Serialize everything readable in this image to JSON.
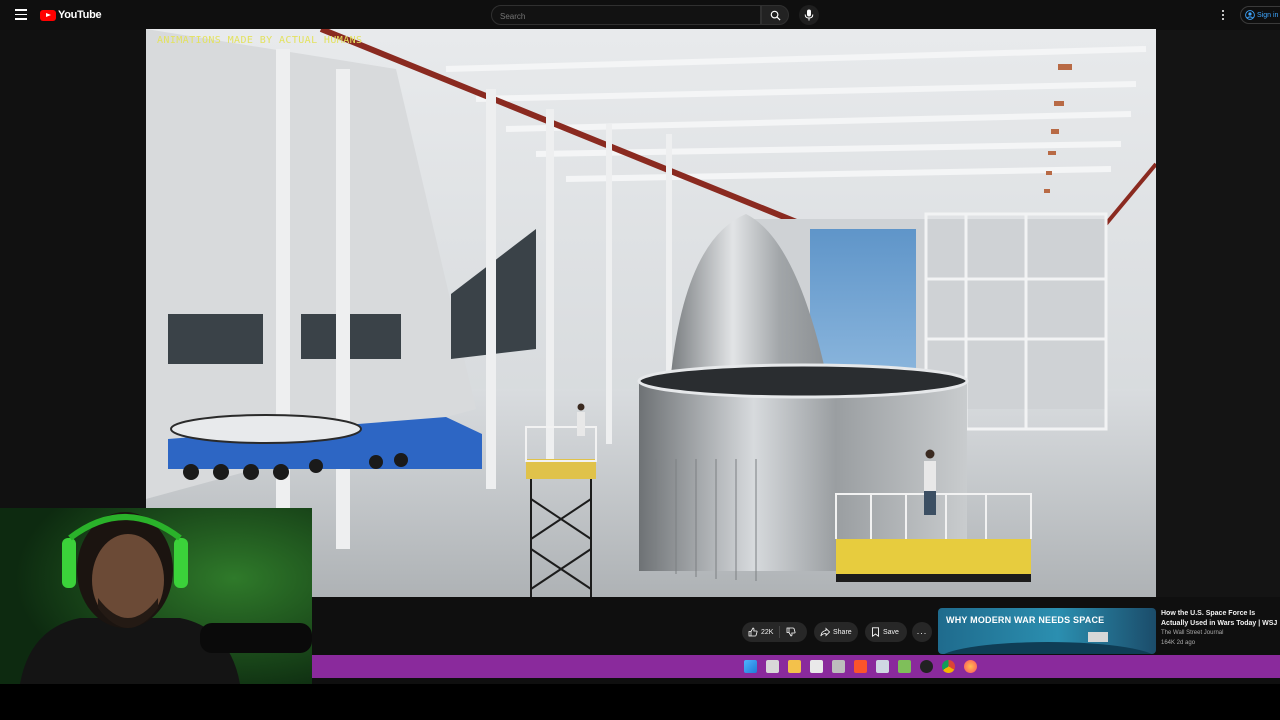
{
  "header": {
    "logo_text": "YouTube",
    "search_placeholder": "Search",
    "signin_label": "Sign in"
  },
  "video": {
    "overlay_text": "ANIMATIONS MADE BY ACTUAL HUMANS"
  },
  "actions": {
    "like_count": "22K",
    "share_label": "Share",
    "save_label": "Save",
    "more_label": "..."
  },
  "recommendation": {
    "thumbnail_text": "WHY MODERN WAR NEEDS SPACE",
    "title": "How the U.S. Space Force Is Actually Used in Wars Today | WSJ",
    "channel": "The Wall Street Journal",
    "meta": "164K  2d ago"
  },
  "colors": {
    "accent": "#3ea6ff",
    "brand": "#ff0000",
    "taskbar": "#8a2a9c",
    "overlay_text": "#e3e25f"
  },
  "taskbar_icons": [
    "windows-start-icon",
    "task-view-icon",
    "file-explorer-icon",
    "notepad-icon",
    "settings-icon",
    "brave-browser-icon",
    "document-icon",
    "app-icon",
    "obs-icon",
    "chrome-icon",
    "firefox-icon"
  ]
}
